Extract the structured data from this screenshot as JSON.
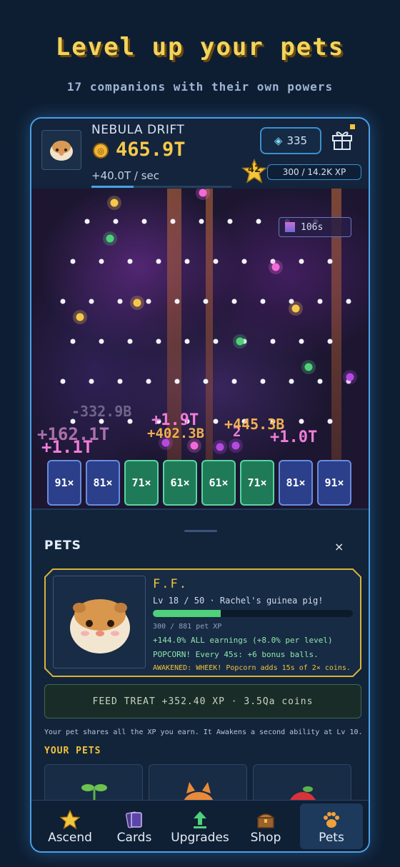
{
  "promo": {
    "headline": "Level up your pets",
    "subline": "17 companions with their own powers"
  },
  "header": {
    "world_name": "NEBULA DRIFT",
    "coins": "465.9T",
    "rate": "+40.0T / sec",
    "gems": "335",
    "level": "42",
    "xp": "300 / 14.2K XP"
  },
  "board": {
    "timer": "106s",
    "floaters": [
      "-332.9B",
      "+162.1T",
      "+1.1T",
      "+1.9T",
      "+402.3B",
      "2",
      "+445.3B",
      "+1.0T"
    ],
    "multipliers": [
      "91×",
      "81×",
      "71×",
      "61×",
      "61×",
      "71×",
      "81×",
      "91×"
    ]
  },
  "pets_panel": {
    "title": "PETS",
    "close": "×",
    "selected": {
      "name": "F.F.",
      "meta": "Lv 18 / 50  ·  Rachel's guinea pig!",
      "xp": "300 / 881 pet XP",
      "xp_fraction": 0.34,
      "perk1": "+144.0% ALL earnings (+8.0% per level)",
      "perk2": "POPCORN! Every 45s: +6 bonus balls.",
      "awakened": "AWAKENED: WHEEK! Popcorn adds 15s of 2× coins."
    },
    "feed_button": "FEED TREAT  +352.40 XP  ·  3.5Qa coins",
    "note": "Your pet shares all the XP you earn. It Awakens a second ability at Lv 10.",
    "your_pets_title": "YOUR PETS"
  },
  "nav": {
    "items": [
      {
        "label": "Ascend",
        "icon": "star-icon"
      },
      {
        "label": "Cards",
        "icon": "cards-icon"
      },
      {
        "label": "Upgrades",
        "icon": "upgrade-arrow-icon"
      },
      {
        "label": "Shop",
        "icon": "treasure-chest-icon"
      },
      {
        "label": "Pets",
        "icon": "paw-icon"
      }
    ],
    "active": "Pets"
  },
  "colors": {
    "accent_gold": "#f0c33a",
    "accent_blue": "#4aa0e6",
    "xp_green": "#4fd07a",
    "background": "#0e1e32"
  }
}
